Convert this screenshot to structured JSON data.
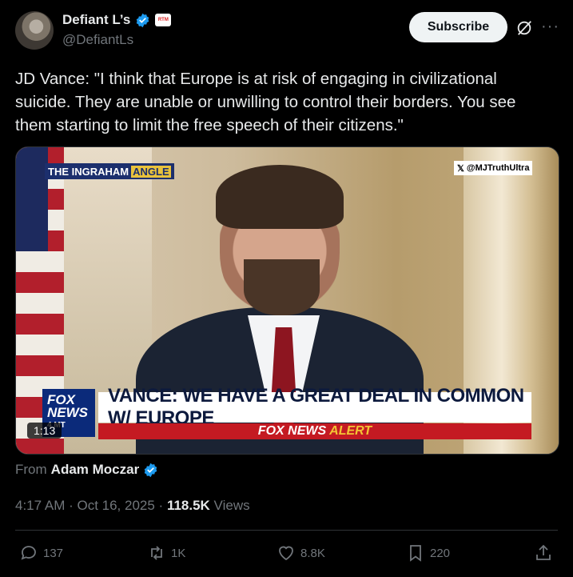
{
  "author": {
    "display_name": "Defiant L’s",
    "handle": "@DefiantLs",
    "affiliate_badge": "RTM"
  },
  "header": {
    "subscribe_label": "Subscribe",
    "more_label": "···"
  },
  "tweet": {
    "text": "JD Vance: \"I think that Europe is at risk of engaging in civilizational suicide. They are unable or unwilling to control their borders. You see them starting to limit the free speech of their citizens.\""
  },
  "media": {
    "show_logo_part1": "THE INGRAHAM",
    "show_logo_part2": "ANGLE",
    "watermark": "@MJTruthUltra",
    "network_logo": "FOX NEWS",
    "network_sublabel": "4 MT",
    "headline": "VANCE: WE HAVE A GREAT DEAL IN COMMON W/ EUROPE",
    "alert_prefix": "FOX NEWS",
    "alert_word": "ALERT",
    "duration": "1:13"
  },
  "source": {
    "from_label": "From",
    "name": "Adam Moczar"
  },
  "meta": {
    "timestamp": "4:17 AM · Oct 16, 2025 · ",
    "views_count": "118.5K",
    "views_label": " Views"
  },
  "actions": {
    "replies": "137",
    "reposts": "1K",
    "likes": "8.8K",
    "bookmarks": "220"
  },
  "colors": {
    "background": "#000000",
    "verified": "#1d9bf0",
    "muted_text": "#71767b"
  }
}
